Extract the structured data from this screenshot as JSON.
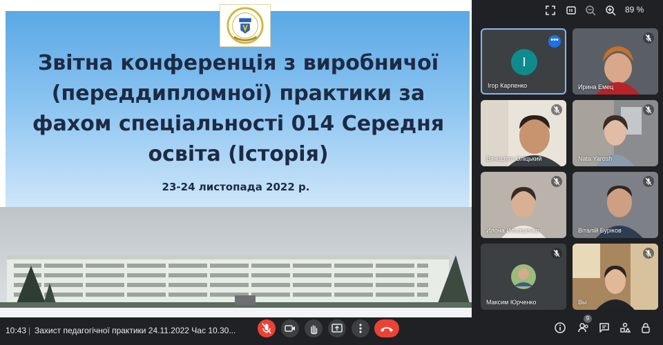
{
  "slide": {
    "title_line1": "Звітна конференція з виробничої",
    "title_line2": "(переддипломної) практики за",
    "title_line3": "фахом спеціальності 014 Середня",
    "title_line4": "освіта (Історія)",
    "date": "23-24 листопада 2022 р."
  },
  "toolbar": {
    "zoom_level": "89 %",
    "icons": [
      "fullscreen-icon",
      "fit-icon",
      "zoom-out-icon",
      "zoom-in-icon"
    ]
  },
  "participants": [
    {
      "name": "Ігор Карпенко",
      "avatar": "І",
      "avatar_color": "#0f8b8d",
      "active": true
    },
    {
      "name": "Ирина Емец",
      "muted": true
    },
    {
      "name": "Вячеслав Оліцький",
      "muted": true
    },
    {
      "name": "Nata Yarosh",
      "muted": true
    },
    {
      "name": "Илона Ильяшенко",
      "muted": true
    },
    {
      "name": "Віталій Буріков",
      "muted": true
    },
    {
      "name": "Максим Юрченко",
      "muted": true
    },
    {
      "name": "Вы",
      "muted": true
    }
  ],
  "bottom": {
    "time": "10:43",
    "separator": "|",
    "meeting_title": "Захист педагогічної практики 24.11.2022 Час 10.30...",
    "people_count": "9"
  },
  "colors": {
    "accent": "#8ab4f8",
    "danger": "#ea4335",
    "background": "#202124",
    "tile": "#3c4043"
  }
}
